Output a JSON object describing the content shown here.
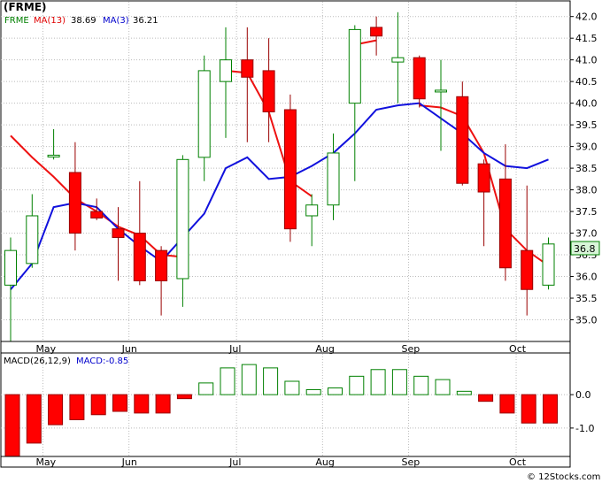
{
  "title": "(FRME)",
  "legend": {
    "symbol": "FRME",
    "ma_fast_label": "MA(13)",
    "ma_fast_value": "38.69",
    "ma_slow_label": "MA(3)",
    "ma_slow_value": "36.21"
  },
  "macd_legend": {
    "label": "MACD(26,12,9)",
    "value_label": "MACD:-0.85"
  },
  "last_price_label": "36.8",
  "watermark": "© 12Stocks.com",
  "colors": {
    "up": "#008000",
    "down": "#ff0000",
    "ma13": "#ee1111",
    "ma3": "#1111dd",
    "grid": "#bbbbbb",
    "price_badge_border": "#008000",
    "price_badge_fill": "#d8f5d8"
  },
  "chart_data": [
    {
      "type": "candlestick",
      "panel": "price",
      "ylim": [
        34.5,
        42.3
      ],
      "y_ticks": [
        "35.0",
        "35.5",
        "36.0",
        "36.5",
        "37.0",
        "37.5",
        "38.0",
        "38.5",
        "39.0",
        "39.5",
        "40.0",
        "40.5",
        "41.0",
        "41.5",
        "42.0"
      ],
      "x_tick_labels": [
        "May",
        "Jun",
        "Jul",
        "Aug",
        "Sep",
        "Oct"
      ],
      "x_tick_after_bar": [
        1,
        5,
        10,
        14,
        18,
        23
      ],
      "candles": [
        {
          "open": 35.8,
          "high": 36.9,
          "low": 34.5,
          "close": 36.6
        },
        {
          "open": 36.3,
          "high": 37.9,
          "low": 36.2,
          "close": 37.4
        },
        {
          "open": 38.8,
          "high": 39.4,
          "low": 38.7,
          "close": 38.8
        },
        {
          "open": 38.4,
          "high": 39.1,
          "low": 36.6,
          "close": 37.0
        },
        {
          "open": 37.5,
          "high": 37.8,
          "low": 37.3,
          "close": 37.35
        },
        {
          "open": 37.1,
          "high": 37.6,
          "low": 35.9,
          "close": 36.9
        },
        {
          "open": 37.0,
          "high": 38.2,
          "low": 35.8,
          "close": 35.9
        },
        {
          "open": 36.6,
          "high": 36.7,
          "low": 35.1,
          "close": 35.9
        },
        {
          "open": 35.95,
          "high": 38.8,
          "low": 35.3,
          "close": 38.7
        },
        {
          "open": 38.75,
          "high": 41.1,
          "low": 38.2,
          "close": 40.75
        },
        {
          "open": 40.5,
          "high": 41.75,
          "low": 39.2,
          "close": 41.0
        },
        {
          "open": 41.0,
          "high": 41.75,
          "low": 39.1,
          "close": 40.6
        },
        {
          "open": 40.75,
          "high": 41.5,
          "low": 39.1,
          "close": 39.8
        },
        {
          "open": 39.85,
          "high": 40.2,
          "low": 36.8,
          "close": 37.1
        },
        {
          "open": 37.4,
          "high": 37.9,
          "low": 36.7,
          "close": 37.65
        },
        {
          "open": 37.65,
          "high": 39.3,
          "low": 37.3,
          "close": 38.85
        },
        {
          "open": 40.0,
          "high": 41.8,
          "low": 38.2,
          "close": 41.7
        },
        {
          "open": 41.75,
          "high": 42.0,
          "low": 41.1,
          "close": 41.55
        },
        {
          "open": 40.95,
          "high": 42.1,
          "low": 40.0,
          "close": 41.05
        },
        {
          "open": 41.05,
          "high": 41.1,
          "low": 39.9,
          "close": 40.1
        },
        {
          "open": 40.3,
          "high": 41.0,
          "low": 38.9,
          "close": 40.3
        },
        {
          "open": 40.15,
          "high": 40.5,
          "low": 38.1,
          "close": 38.15
        },
        {
          "open": 38.6,
          "high": 38.7,
          "low": 36.7,
          "close": 37.95
        },
        {
          "open": 38.25,
          "high": 39.05,
          "low": 35.9,
          "close": 36.2
        },
        {
          "open": 36.6,
          "high": 38.1,
          "low": 35.1,
          "close": 35.7
        },
        {
          "open": 35.8,
          "high": 36.9,
          "low": 35.7,
          "close": 36.75
        }
      ],
      "series": [
        {
          "name": "MA(13)",
          "values": [
            39.25,
            38.75,
            38.3,
            37.8,
            37.5,
            37.15,
            36.95,
            36.5,
            36.45,
            null,
            40.75,
            40.7,
            39.8,
            38.2,
            37.85,
            null,
            41.35,
            41.45,
            null,
            39.95,
            39.9,
            39.7,
            38.85,
            37.1,
            36.6,
            36.25
          ]
        }
      ]
    },
    {
      "type": "line",
      "panel": "price",
      "series": [
        {
          "name": "MA(3)",
          "values": [
            35.7,
            36.3,
            37.6,
            37.7,
            37.6,
            37.1,
            36.7,
            36.35,
            36.9,
            37.45,
            38.5,
            38.75,
            38.25,
            38.3,
            38.55,
            38.85,
            39.3,
            39.85,
            39.95,
            40.0,
            39.65,
            39.3,
            38.85,
            38.55,
            38.5,
            38.7
          ]
        }
      ]
    },
    {
      "type": "bar",
      "panel": "macd",
      "ylim": [
        -1.85,
        0.85
      ],
      "y_ticks": [
        "0.0",
        "-1.0"
      ],
      "x_tick_labels": [
        "May",
        "Jun",
        "Jul",
        "Aug",
        "Sep",
        "Oct"
      ],
      "values": [
        -1.85,
        -1.45,
        -0.9,
        -0.75,
        -0.6,
        -0.5,
        -0.55,
        -0.55,
        -0.12,
        0.35,
        0.8,
        0.9,
        0.8,
        0.4,
        0.15,
        0.2,
        0.55,
        0.75,
        0.75,
        0.55,
        0.45,
        0.1,
        -0.2,
        -0.55,
        -0.85,
        -0.85
      ]
    }
  ]
}
